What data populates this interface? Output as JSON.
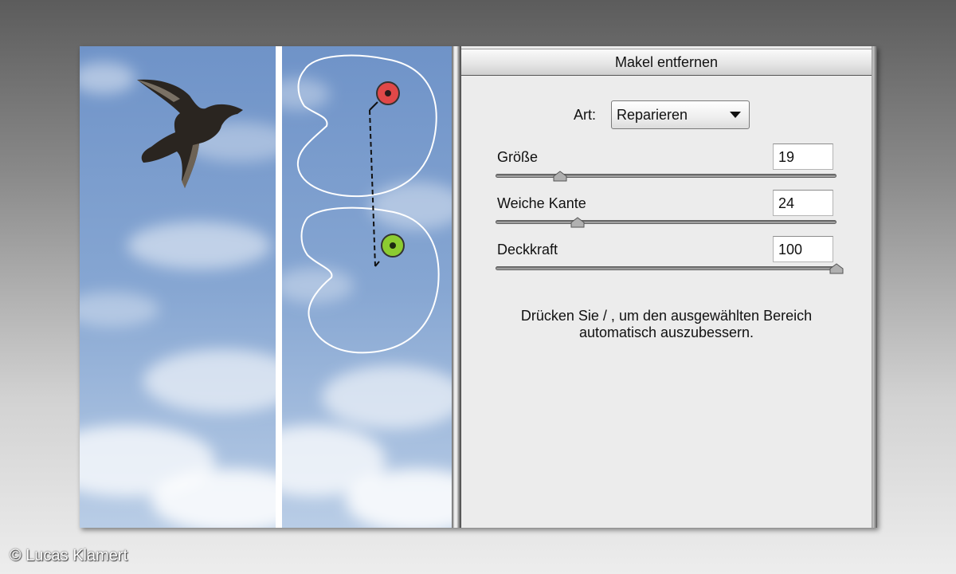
{
  "panel": {
    "title": "Makel entfernen",
    "type_label": "Art:",
    "type_value": "Reparieren",
    "sliders": [
      {
        "label": "Größe",
        "value": "19",
        "level": 0.19
      },
      {
        "label": "Weiche Kante",
        "value": "24",
        "level": 0.24
      },
      {
        "label": "Deckkraft",
        "value": "100",
        "level": 1.0
      }
    ],
    "hint_line1": "Drücken Sie / , um den ausgewählten Bereich",
    "hint_line2": "automatisch auszubessern."
  },
  "photo": {
    "source_marker_color": "#e04848",
    "target_marker_color": "#8ccc30",
    "sky_color": "#7c9ccc"
  },
  "copyright": "© Lucas Klamert"
}
